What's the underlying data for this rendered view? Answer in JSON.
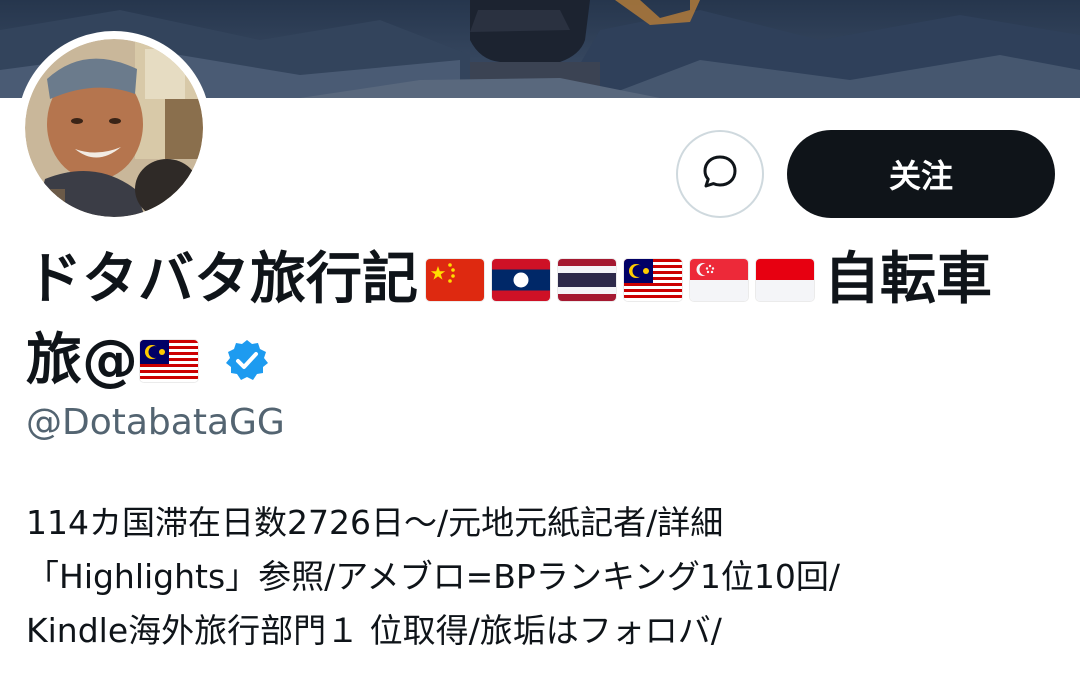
{
  "profile": {
    "name_line1": "ドタバタ旅行記",
    "name_line1_suffix": "自転車",
    "name_line2": "旅@",
    "handle": "@DotabataGG",
    "verified": true,
    "name_flags_line1": [
      "china-flag",
      "laos-flag",
      "thailand-flag",
      "malaysia-flag",
      "singapore-flag",
      "indonesia-flag"
    ],
    "name_flags_line2": [
      "malaysia-flag"
    ],
    "bio_lines": [
      "114カ国滞在日数2726日～/元地元紙記者/詳細",
      "「Highlights」参照/アメブロ=BPランキング1位10回/",
      "Kindle海外旅行部門１ 位取得/旅垢はフォロバ/"
    ]
  },
  "actions": {
    "message_icon": "message-bubble-icon",
    "follow_label": "关注"
  },
  "colors": {
    "follow_bg": "#0f1419",
    "verified_badge": "#1d9bf0",
    "handle_text": "#536471",
    "border": "#cfd9de"
  }
}
